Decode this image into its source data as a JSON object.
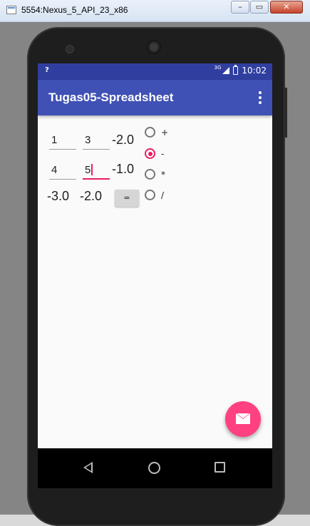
{
  "window": {
    "title": "5554:Nexus_5_API_23_x86",
    "minimize_label": "–",
    "maximize_label": "▭",
    "close_label": "✕"
  },
  "statusbar": {
    "left_icon": "?",
    "network": "3G",
    "time": "10:02"
  },
  "appbar": {
    "title": "Tugas05-Spreadsheet",
    "overflow_icon": "more-vert-icon"
  },
  "grid": {
    "row1": {
      "a": "1",
      "b": "3",
      "result": "-2.0"
    },
    "row2": {
      "a": "4",
      "b": "5",
      "result": "-1.0"
    },
    "row3": {
      "a": "-3.0",
      "b": "-2.0"
    }
  },
  "equals_button": {
    "label": "="
  },
  "operators": {
    "selected": "-",
    "items": [
      {
        "label": "+",
        "checked": false
      },
      {
        "label": "-",
        "checked": true
      },
      {
        "label": "*",
        "checked": false
      },
      {
        "label": "/",
        "checked": false
      }
    ]
  },
  "fab": {
    "icon": "mail-icon",
    "color": "#ff4081"
  },
  "colors": {
    "primary": "#3f51b5",
    "primary_dark": "#303f9f",
    "accent": "#e91e63"
  }
}
